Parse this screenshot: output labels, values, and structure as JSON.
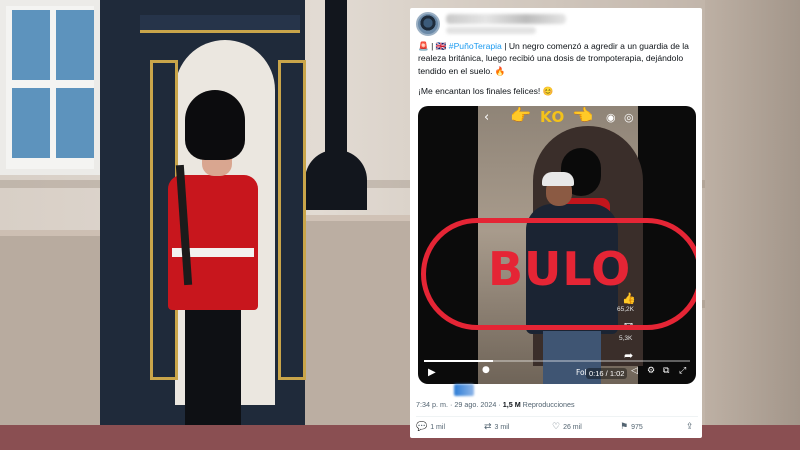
{
  "tweet": {
    "text_prefix": "🚨 | 🇬🇧 ",
    "hashtag": "#PuñoTerapia",
    "text_body": " | Un negro comenzó a agredir a un guardia de la realeza británica, luego recibió una dosis de trompoterapia, dejándolo tendido en el suelo. 🔥",
    "text_second": "¡Me encantan los finales felices! 😊"
  },
  "video": {
    "overlay_text": "KO",
    "thumb_emoji": "👉",
    "thumb_emoji_right": "👈",
    "bulo_label": "BULO",
    "likes": "65,2K",
    "comments": "5,3K",
    "time": "0:16 / 1:02",
    "progress": 0.26,
    "follow_fragment": "Fol"
  },
  "meta": {
    "timestamp": "7:34 p. m. · 29 ago. 2024 · ",
    "views": "1,5 M",
    "views_label": " Reproducciones"
  },
  "actions": {
    "replies": "1 mil",
    "reposts": "3 mil",
    "likes": "26 mil",
    "bookmarks": "975"
  },
  "colors": {
    "bulo": "#e52535",
    "hashtag": "#1d9bf0",
    "ko": "#f3c21a"
  }
}
